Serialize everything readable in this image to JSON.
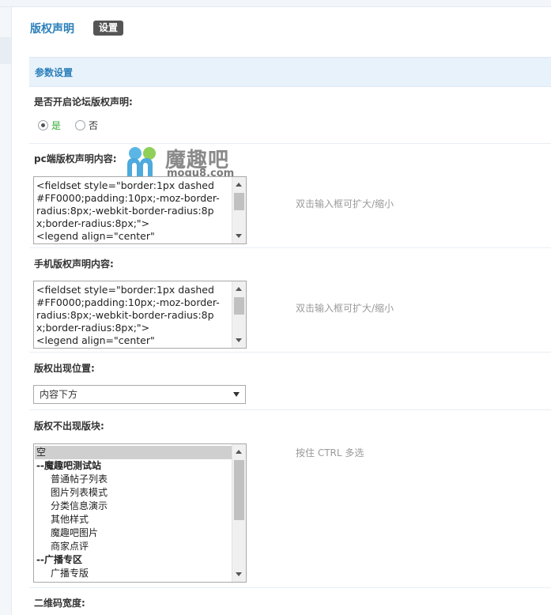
{
  "header": {
    "title": "版权声明",
    "settings_button": "设置"
  },
  "section": {
    "title": "参数设置"
  },
  "forum_copyright": {
    "label": "是否开启论坛版权声明:",
    "options": [
      {
        "label": "是",
        "checked": true
      },
      {
        "label": "否",
        "checked": false
      }
    ]
  },
  "pc_content": {
    "label": "pc端版权声明内容:",
    "value": "<fieldset style=\"border:1px dashed #FF0000;padding:10px;-moz-border-radius:8px;-webkit-border-radius:8px;border-radius:8px;\">\n<legend align=\"center\"",
    "hint": "双击输入框可扩大/缩小"
  },
  "mobile_content": {
    "label": "手机版权声明内容:",
    "value": "<fieldset style=\"border:1px dashed #FF0000;padding:10px;-moz-border-radius:8px;-webkit-border-radius:8px;border-radius:8px;\">\n<legend align=\"center\"",
    "hint": "双击输入框可扩大/缩小"
  },
  "position": {
    "label": "版权出现位置:",
    "selected": "内容下方"
  },
  "excluded_blocks": {
    "label": "版权不出现版块:",
    "hint": "按住 CTRL 多选",
    "options": [
      {
        "label": "空",
        "selected": true,
        "group": false
      },
      {
        "label": "--魔趣吧测试站",
        "selected": false,
        "group": true
      },
      {
        "label": "普通帖子列表",
        "selected": false,
        "group": false
      },
      {
        "label": "图片列表模式",
        "selected": false,
        "group": false
      },
      {
        "label": "分类信息演示",
        "selected": false,
        "group": false
      },
      {
        "label": "其他样式",
        "selected": false,
        "group": false
      },
      {
        "label": "魔趣吧图片",
        "selected": false,
        "group": false
      },
      {
        "label": "商家点评",
        "selected": false,
        "group": false
      },
      {
        "label": "--广播专区",
        "selected": false,
        "group": true
      },
      {
        "label": "广播专版",
        "selected": false,
        "group": false
      }
    ]
  },
  "qr_width": {
    "label": "二维码宽度:"
  },
  "watermark": {
    "text": "魔趣吧",
    "sub": "moqu8.com"
  }
}
